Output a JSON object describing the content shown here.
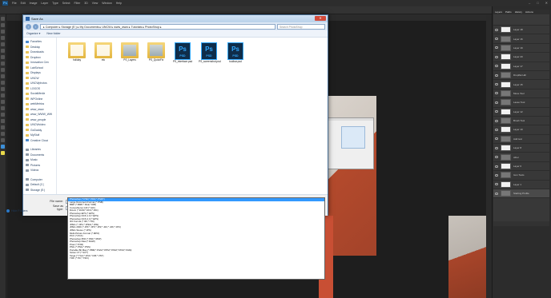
{
  "photoshop": {
    "menu": [
      "File",
      "Edit",
      "Image",
      "Layer",
      "Type",
      "Select",
      "Filter",
      "3D",
      "View",
      "Window",
      "Help"
    ],
    "window_controls": [
      "–",
      "□",
      "✕"
    ],
    "layers_tabs": [
      "Layers",
      "Paths",
      "History",
      "Actions"
    ],
    "layers": [
      {
        "name": "Layer 18",
        "thumb": "white"
      },
      {
        "name": "Layer 16",
        "thumb": "dark"
      },
      {
        "name": "Layer 19",
        "thumb": "dark"
      },
      {
        "name": "Layer 20",
        "thumb": "white"
      },
      {
        "name": "Layer 17",
        "thumb": "white"
      },
      {
        "name": "Dropflat Hdr",
        "thumb": "dark"
      },
      {
        "name": "Layer 15",
        "thumb": "white"
      },
      {
        "name": "Move Tool",
        "thumb": "dark"
      },
      {
        "name": "Lasso Tool",
        "thumb": "dark"
      },
      {
        "name": "Layer 12",
        "thumb": "white"
      },
      {
        "name": "Brush Tool",
        "thumb": "dark"
      },
      {
        "name": "Layer 10",
        "thumb": "white"
      },
      {
        "name": "Add text",
        "thumb": "dark"
      },
      {
        "name": "Layer 8",
        "thumb": "white"
      },
      {
        "name": "other",
        "thumb": "dark"
      },
      {
        "name": "Layer 6",
        "thumb": "white"
      },
      {
        "name": "Icon Tools",
        "thumb": "dark"
      },
      {
        "name": "Layer 1",
        "thumb": "white"
      },
      {
        "name": "Starting Profile",
        "thumb": "dark"
      }
    ]
  },
  "dialog": {
    "title": "Save As",
    "close": "✕",
    "address": "▸ Computer ▸ Storage (E:) ▸ My Documents ▸ UNCW ▸ www_www ▸ Tutorials ▸ PhotoShop ▸",
    "search_placeholder": "Search PhotoShop",
    "organize": "Organize ▾",
    "new_folder": "New folder",
    "nav_items": [
      {
        "label": "Favorites",
        "icon": "blue"
      },
      {
        "label": "Desktop",
        "icon": "yellow"
      },
      {
        "label": "Downloads",
        "icon": "yellow"
      },
      {
        "label": "Dropbox",
        "icon": "yellow"
      },
      {
        "label": "Innovation Cen",
        "icon": "yellow"
      },
      {
        "label": "LabSchool",
        "icon": "yellow"
      },
      {
        "label": "Displays",
        "icon": "yellow"
      },
      {
        "label": "UNCW",
        "icon": "yellow"
      },
      {
        "label": "UNCWphotos",
        "icon": "yellow"
      },
      {
        "label": "LOGOS",
        "icon": "yellow"
      },
      {
        "label": "SocialMedia",
        "icon": "yellow"
      },
      {
        "label": "WPOnline",
        "icon": "yellow"
      },
      {
        "label": "webMetrics",
        "icon": "yellow"
      },
      {
        "label": "www_www",
        "icon": "yellow"
      },
      {
        "label": "www_WWW_WW",
        "icon": "yellow"
      },
      {
        "label": "www_people",
        "icon": "yellow"
      },
      {
        "label": "UNCWvideo",
        "icon": "yellow"
      },
      {
        "label": "GoDaddy",
        "icon": "yellow"
      },
      {
        "label": "MyStuff",
        "icon": "yellow"
      },
      {
        "label": "Creative Cloud",
        "icon": "blue"
      }
    ],
    "library_items": [
      {
        "label": "Libraries",
        "icon": "gray"
      },
      {
        "label": "Documents",
        "icon": "gray"
      },
      {
        "label": "Music",
        "icon": "gray"
      },
      {
        "label": "Pictures",
        "icon": "gray"
      },
      {
        "label": "Videos",
        "icon": "gray"
      }
    ],
    "computer_items": [
      {
        "label": "Computer",
        "icon": "gray"
      },
      {
        "label": "Default (C:)",
        "icon": "gray"
      },
      {
        "label": "Storage (E:)",
        "icon": "gray"
      }
    ],
    "files": [
      {
        "label": "holiday",
        "kind": "folder"
      },
      {
        "label": "etc",
        "kind": "folder"
      },
      {
        "label": "PS_Layers",
        "kind": "folder"
      },
      {
        "label": "PS_QuickFix",
        "kind": "folder"
      },
      {
        "label": "PS_interface.psd",
        "kind": "psd"
      },
      {
        "label": "PS_screenshot.psd",
        "kind": "psd"
      },
      {
        "label": "toolbar.psd",
        "kind": "psd"
      }
    ],
    "file_name_label": "File name:",
    "file_name_value": "PS_interface.psd",
    "save_type_label": "Save as type:",
    "save_type_value": "Photoshop (*.PSD;*.PDD;*.PSDT)",
    "hide_folders": "Hide Folders",
    "type_options": [
      "Photoshop (*.PSD;*.PDD;*.PSDT)",
      "Large Document Format (*.PSB)",
      "BMP (*.BMP;*.RLE;*.DIB)",
      "CompuServe GIF (*.GIF)",
      "Dicom (*.DCM;*.DC3;*.DIC)",
      "Photoshop EPS (*.EPS)",
      "Photoshop DCS 1.0 (*.EPS)",
      "Photoshop DCS 2.0 (*.EPS)",
      "IFF Format (*.IFF;*.TDI)",
      "JPEG (*.JPG;*.JPEG;*.JPE)",
      "JPEG 2000 (*.JPF;*.JPX;*.JP2;*.J2C;*.J2K;*.JPC)",
      "JPEG Stereo (*.JPS)",
      "Multi-Picture Format (*.MPO)",
      "PCX (*.PCX)",
      "Photoshop PDF (*.PDF;*.PDP)",
      "Photoshop Raw (*.RAW)",
      "Pixar (*.PXR)",
      "PNG (*.PNG;*.PNS)",
      "Portable Bit Map (*.PBM;*.PGM;*.PPM;*.PNM;*.PFM;*.PAM)",
      "Scitex CT (*.SCT)",
      "Targa (*.TGA;*.VDA;*.ICB;*.VST)",
      "TIFF (*.TIF;*.TIFF)"
    ]
  }
}
